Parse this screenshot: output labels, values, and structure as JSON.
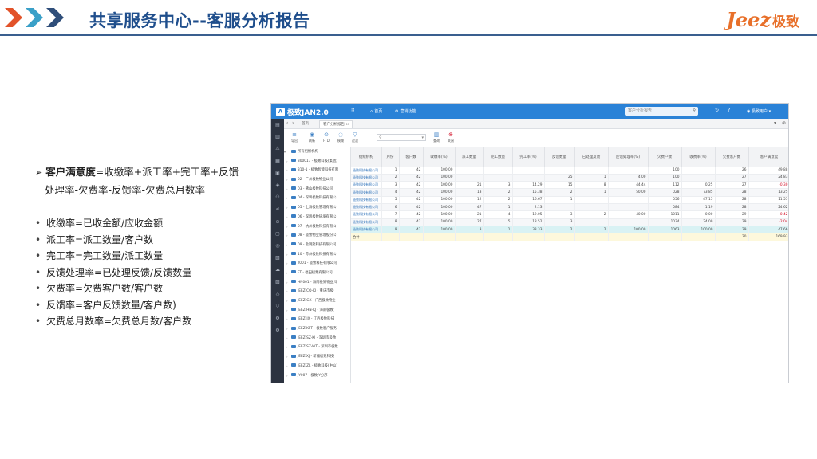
{
  "header": {
    "title": "共享服务中心--客服分析报告",
    "logo_en": "Jeez",
    "logo_cn": "极致",
    "chevron_colors": [
      "#e2532a",
      "#3aa0c8",
      "#2f4e7a"
    ]
  },
  "formula": {
    "arrow": "➢",
    "term": "客户满意度",
    "line1_rest": "=收缴率+派工率+完工率+反馈",
    "line2": "处理率-欠费率-反馈率-欠费总月数率"
  },
  "definitions": [
    "收缴率=已收金额/应收金额",
    "派工率=派工数量/客户数",
    "完工率=完工数量/派工数量",
    "反馈处理率=已处理反馈/反馈数量",
    "欠费率=欠费客户数/客户数",
    "反馈率=客户反馈数量/客户数)",
    "欠费总月数率=欠费总月数/客户数"
  ],
  "app": {
    "brand": "极致JAN2.0",
    "nav_home": "首页",
    "nav_manage": "营销功能",
    "search_placeholder": "客户分析报告",
    "user": "极致用户",
    "tabs": {
      "home": "首页",
      "report": "客户分析报告"
    },
    "toolbar": {
      "btn1": "导出",
      "btn2": "刷新",
      "btn3": "FTD",
      "btn4": "模糊",
      "btn5": "过滤",
      "btn6": "查询",
      "btn7": "关闭"
    },
    "tree": {
      "root": "所有组织机构",
      "items": [
        "300017 - 极致科技(集团)",
        "310-1 - 极致智能科技有限",
        "02 - 广州极致物业公司",
        "03 - 佛山极致科技公司",
        "04 - 深圳极致科技有限公",
        "05 - 上海极致管理有限公",
        "06 - 深圳极致研发有限公",
        "07 - 杭州极致科技有限公",
        "08 - 极致物业管理股份公",
        "09 - 金钥匙科技有限公司",
        "10 - 苏州极致科技有限公",
        "z001 - 极致科技有限公司",
        "FT - 福田极致有限公司",
        "HN001 - 海南极致物业科",
        "JEEZ-CQ-KJ - 重庆市极",
        "JEEZ-GX - 广西极致物业",
        "JEEZ-HN-KJ - 海南极致",
        "JEEZ-JX - 江西极致科技",
        "JEEZ-KFT - 极致客户服务",
        "JEEZ-SZ-KJ - 深圳市极致",
        "JEEZ-SZ-WT - 深圳市极致",
        "JEEZ-XJ - 新疆极致科技",
        "JEEZ-ZL - 极致科技(中山)",
        "JY007 - 极致JY分部"
      ]
    },
    "table": {
      "headers": [
        "组织机构",
        "月份",
        "客户数",
        "收缴率(%)",
        "派工数量",
        "完工数量",
        "完工率(%)",
        "反馈数量",
        "已处理反馈",
        "反馈处理率(%)",
        "欠费户数",
        "收费率(%)",
        "欠费客户数",
        "客户满意度"
      ],
      "rows": [
        [
          "极致科技有限公司",
          "1",
          "42",
          "100.00",
          "",
          "",
          "",
          "",
          "",
          "",
          "100",
          "",
          "26",
          "49.88"
        ],
        [
          "极致科技有限公司",
          "2",
          "42",
          "100.00",
          "",
          "",
          "",
          "25",
          "1",
          "4.00",
          "100",
          "",
          "27",
          "24.83"
        ],
        [
          "极致科技有限公司",
          "3",
          "42",
          "100.00",
          "21",
          "3",
          "14.29",
          "15",
          "8",
          "44.44",
          "112",
          "0.25",
          "27",
          "-0.30"
        ],
        [
          "极致科技有限公司",
          "4",
          "42",
          "100.00",
          "13",
          "2",
          "15.38",
          "2",
          "1",
          "50.00",
          "028",
          "73.85",
          "28",
          "13.25"
        ],
        [
          "极致科技有限公司",
          "5",
          "42",
          "100.00",
          "12",
          "2",
          "16.67",
          "1",
          "",
          "",
          "056",
          "47.15",
          "28",
          "11.55"
        ],
        [
          "极致科技有限公司",
          "6",
          "42",
          "100.00",
          "47",
          "1",
          "2.13",
          "",
          "",
          "",
          "084",
          "1.19",
          "28",
          "24.62"
        ],
        [
          "极致科技有限公司",
          "7",
          "42",
          "100.00",
          "21",
          "4",
          "19.05",
          "3",
          "2",
          "40.00",
          "1011",
          "0.00",
          "29",
          "-0.42"
        ],
        [
          "极致科技有限公司",
          "8",
          "42",
          "100.00",
          "27",
          "5",
          "18.52",
          "3",
          "",
          "",
          "1034",
          "24.09",
          "29",
          "-2.04"
        ],
        [
          "极致科技有限公司",
          "9",
          "42",
          "100.00",
          "3",
          "1",
          "33.33",
          "2",
          "2",
          "100.00",
          "1063",
          "100.00",
          "29",
          "47.66"
        ]
      ],
      "total_label": "合计",
      "total_count": "20",
      "total_score": "169.93"
    }
  }
}
